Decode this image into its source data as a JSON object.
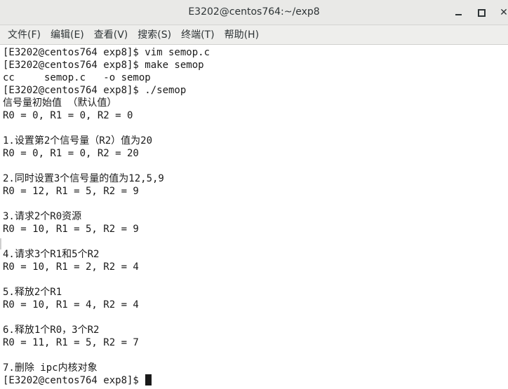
{
  "window": {
    "title": "E3202@centos764:~/exp8"
  },
  "menubar": {
    "items": [
      "文件(F)",
      "编辑(E)",
      "查看(V)",
      "搜索(S)",
      "终端(T)",
      "帮助(H)"
    ]
  },
  "terminal": {
    "lines": [
      "[E3202@centos764 exp8]$ vim semop.c",
      "[E3202@centos764 exp8]$ make semop",
      "cc     semop.c   -o semop",
      "[E3202@centos764 exp8]$ ./semop",
      "信号量初始值 （默认值）",
      "R0 = 0, R1 = 0, R2 = 0",
      "",
      "1.设置第2个信号量（R2）值为20",
      "R0 = 0, R1 = 0, R2 = 20",
      "",
      "2.同时设置3个信号量的值为12,5,9",
      "R0 = 12, R1 = 5, R2 = 9",
      "",
      "3.请求2个R0资源",
      "R0 = 10, R1 = 5, R2 = 9",
      "",
      "4.请求3个R1和5个R2",
      "R0 = 10, R1 = 2, R2 = 4",
      "",
      "5.释放2个R1",
      "R0 = 10, R1 = 4, R2 = 4",
      "",
      "6.释放1个R0，3个R2",
      "R0 = 11, R1 = 5, R2 = 7",
      "",
      "7.删除 ipc内核对象"
    ],
    "prompt": "[E3202@centos764 exp8]$ "
  }
}
